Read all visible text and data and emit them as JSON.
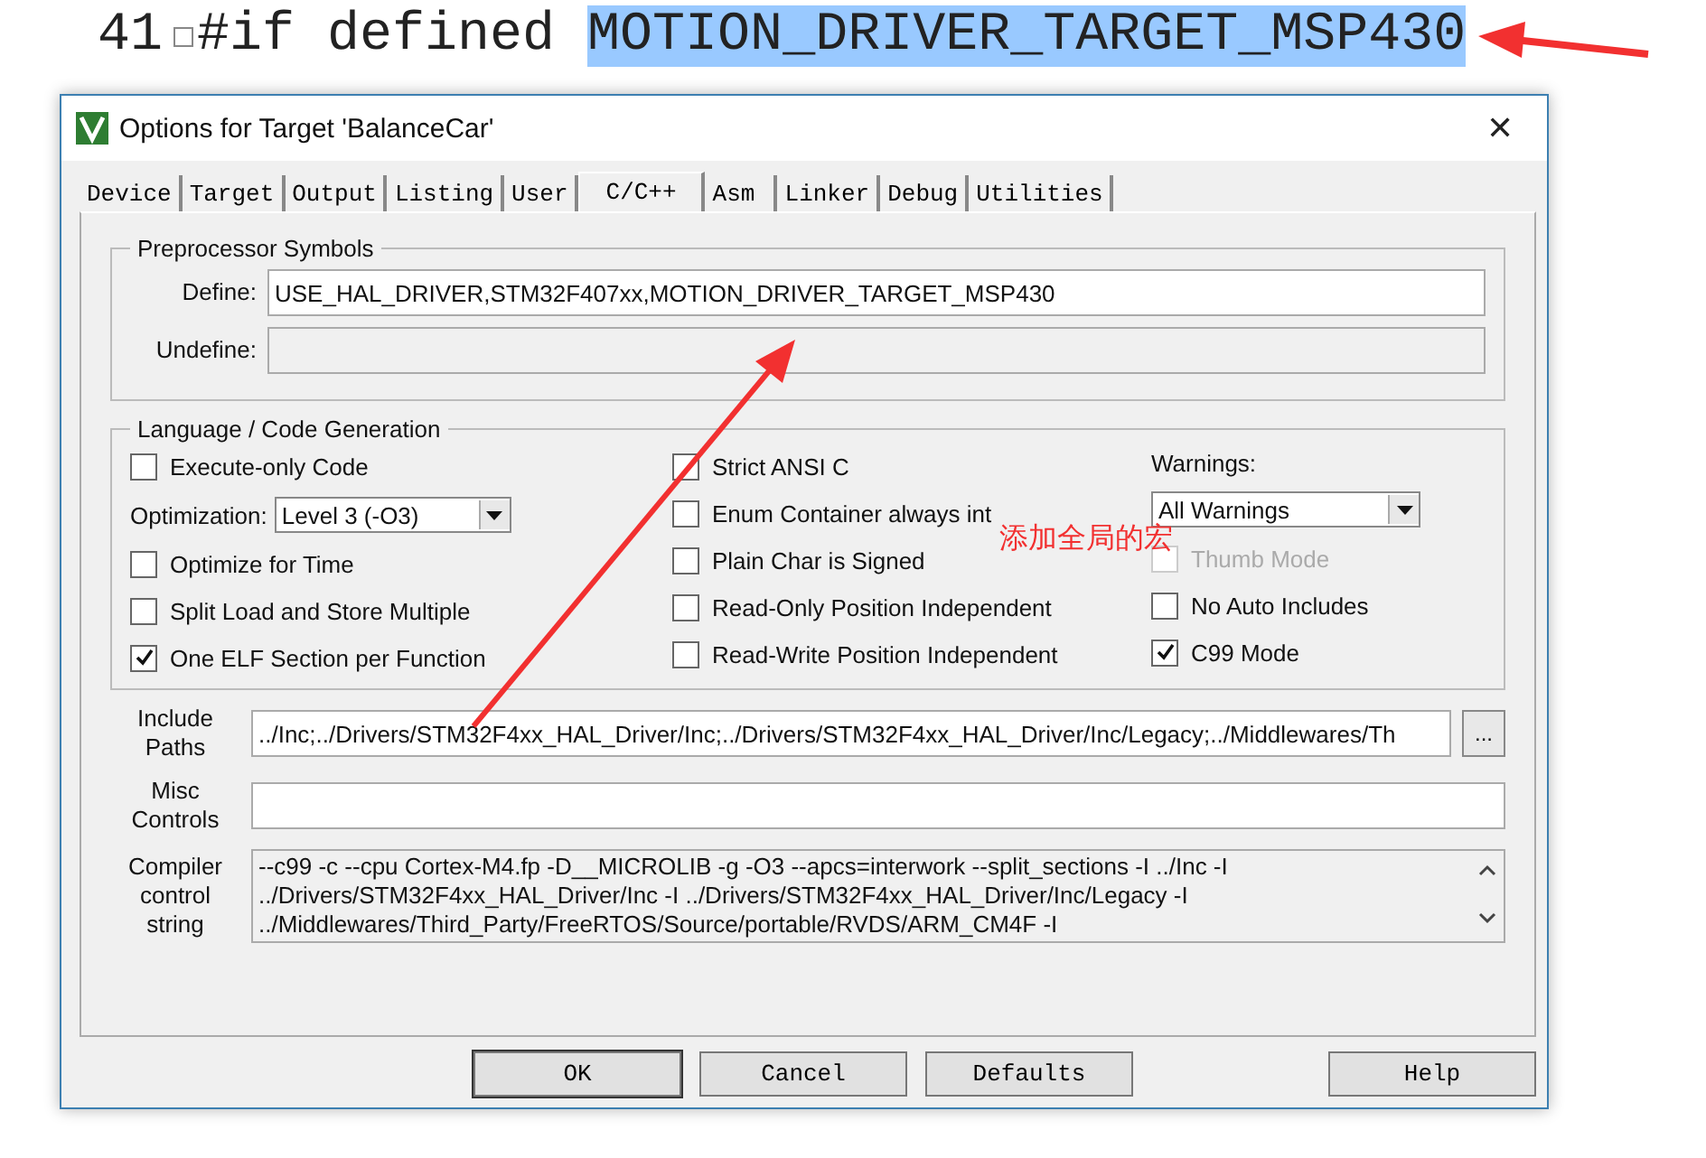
{
  "editor": {
    "lines": [
      {
        "number": "41",
        "parts": [
          {
            "text": "#if defined ",
            "selected": false
          },
          {
            "text": "MOTION_DRIVER_TARGET_MSP430",
            "selected": true
          }
        ]
      }
    ]
  },
  "window": {
    "title": "Options for Target 'BalanceCar'",
    "close": "✕"
  },
  "tabs": [
    {
      "label": "Device",
      "selected": false
    },
    {
      "label": "Target",
      "selected": false
    },
    {
      "label": "Output",
      "selected": false
    },
    {
      "label": "Listing",
      "selected": false
    },
    {
      "label": "User",
      "selected": false
    },
    {
      "label": "C/C++",
      "selected": true
    },
    {
      "label": "Asm",
      "selected": false
    },
    {
      "label": "Linker",
      "selected": false
    },
    {
      "label": "Debug",
      "selected": false
    },
    {
      "label": "Utilities",
      "selected": false
    }
  ],
  "preprocessor": {
    "title": "Preprocessor Symbols",
    "define": {
      "label": "Define:",
      "value": "USE_HAL_DRIVER,STM32F407xx,MOTION_DRIVER_TARGET_MSP430"
    },
    "undefine": {
      "label": "Undefine:"
    }
  },
  "language": {
    "title": "Language / Code Generation",
    "columns": [
      [
        {
          "kind": "checkbox",
          "label": "Execute-only Code",
          "checked": false,
          "disabled": false
        },
        {
          "kind": "select",
          "label": "Optimization:",
          "value": "Level 3 (-O3)"
        },
        {
          "kind": "checkbox",
          "label": "Optimize for Time",
          "checked": false,
          "disabled": false
        },
        {
          "kind": "checkbox",
          "label": "Split Load and Store Multiple",
          "checked": false,
          "disabled": false
        },
        {
          "kind": "checkbox",
          "label": "One ELF Section per Function",
          "checked": true,
          "disabled": false
        }
      ],
      [
        {
          "kind": "checkbox",
          "label": "Strict ANSI C",
          "checked": false,
          "disabled": false
        },
        {
          "kind": "checkbox",
          "label": "Enum Container always int",
          "checked": false,
          "disabled": false
        },
        {
          "kind": "checkbox",
          "label": "Plain Char is Signed",
          "checked": false,
          "disabled": false
        },
        {
          "kind": "checkbox",
          "label": "Read-Only Position Independent",
          "checked": false,
          "disabled": false
        },
        {
          "kind": "checkbox",
          "label": "Read-Write Position Independent",
          "checked": false,
          "disabled": false
        }
      ],
      [
        {
          "kind": "caption",
          "label": "Warnings:"
        },
        {
          "kind": "select",
          "value": "All Warnings"
        },
        {
          "kind": "checkbox",
          "label": "Thumb Mode",
          "checked": false,
          "disabled": true
        },
        {
          "kind": "checkbox",
          "label": "No Auto Includes",
          "checked": false,
          "disabled": false
        },
        {
          "kind": "checkbox",
          "label": "C99 Mode",
          "checked": true,
          "disabled": false
        }
      ]
    ]
  },
  "include_paths": {
    "label": "Include Paths",
    "value": "../Inc;../Drivers/STM32F4xx_HAL_Driver/Inc;../Drivers/STM32F4xx_HAL_Driver/Inc/Legacy;../Middlewares/Th",
    "browse": "..."
  },
  "misc_controls": {
    "label": "Misc Controls"
  },
  "compiler_control": {
    "label": "Compiler control string",
    "lines": [
      "--c99 -c --cpu Cortex-M4.fp -D__MICROLIB -g -O3 --apcs=interwork --split_sections -I ../Inc -I",
      "../Drivers/STM32F4xx_HAL_Driver/Inc -I ../Drivers/STM32F4xx_HAL_Driver/Inc/Legacy -I",
      "../Middlewares/Third_Party/FreeRTOS/Source/portable/RVDS/ARM_CM4F -I"
    ]
  },
  "buttons": [
    {
      "label": "OK",
      "kind": "default"
    },
    {
      "label": "Cancel",
      "kind": "normal"
    },
    {
      "label": "Defaults",
      "kind": "normal"
    },
    {
      "label": "Help",
      "kind": "help"
    }
  ],
  "annotation": {
    "text": "添加全局的宏"
  }
}
